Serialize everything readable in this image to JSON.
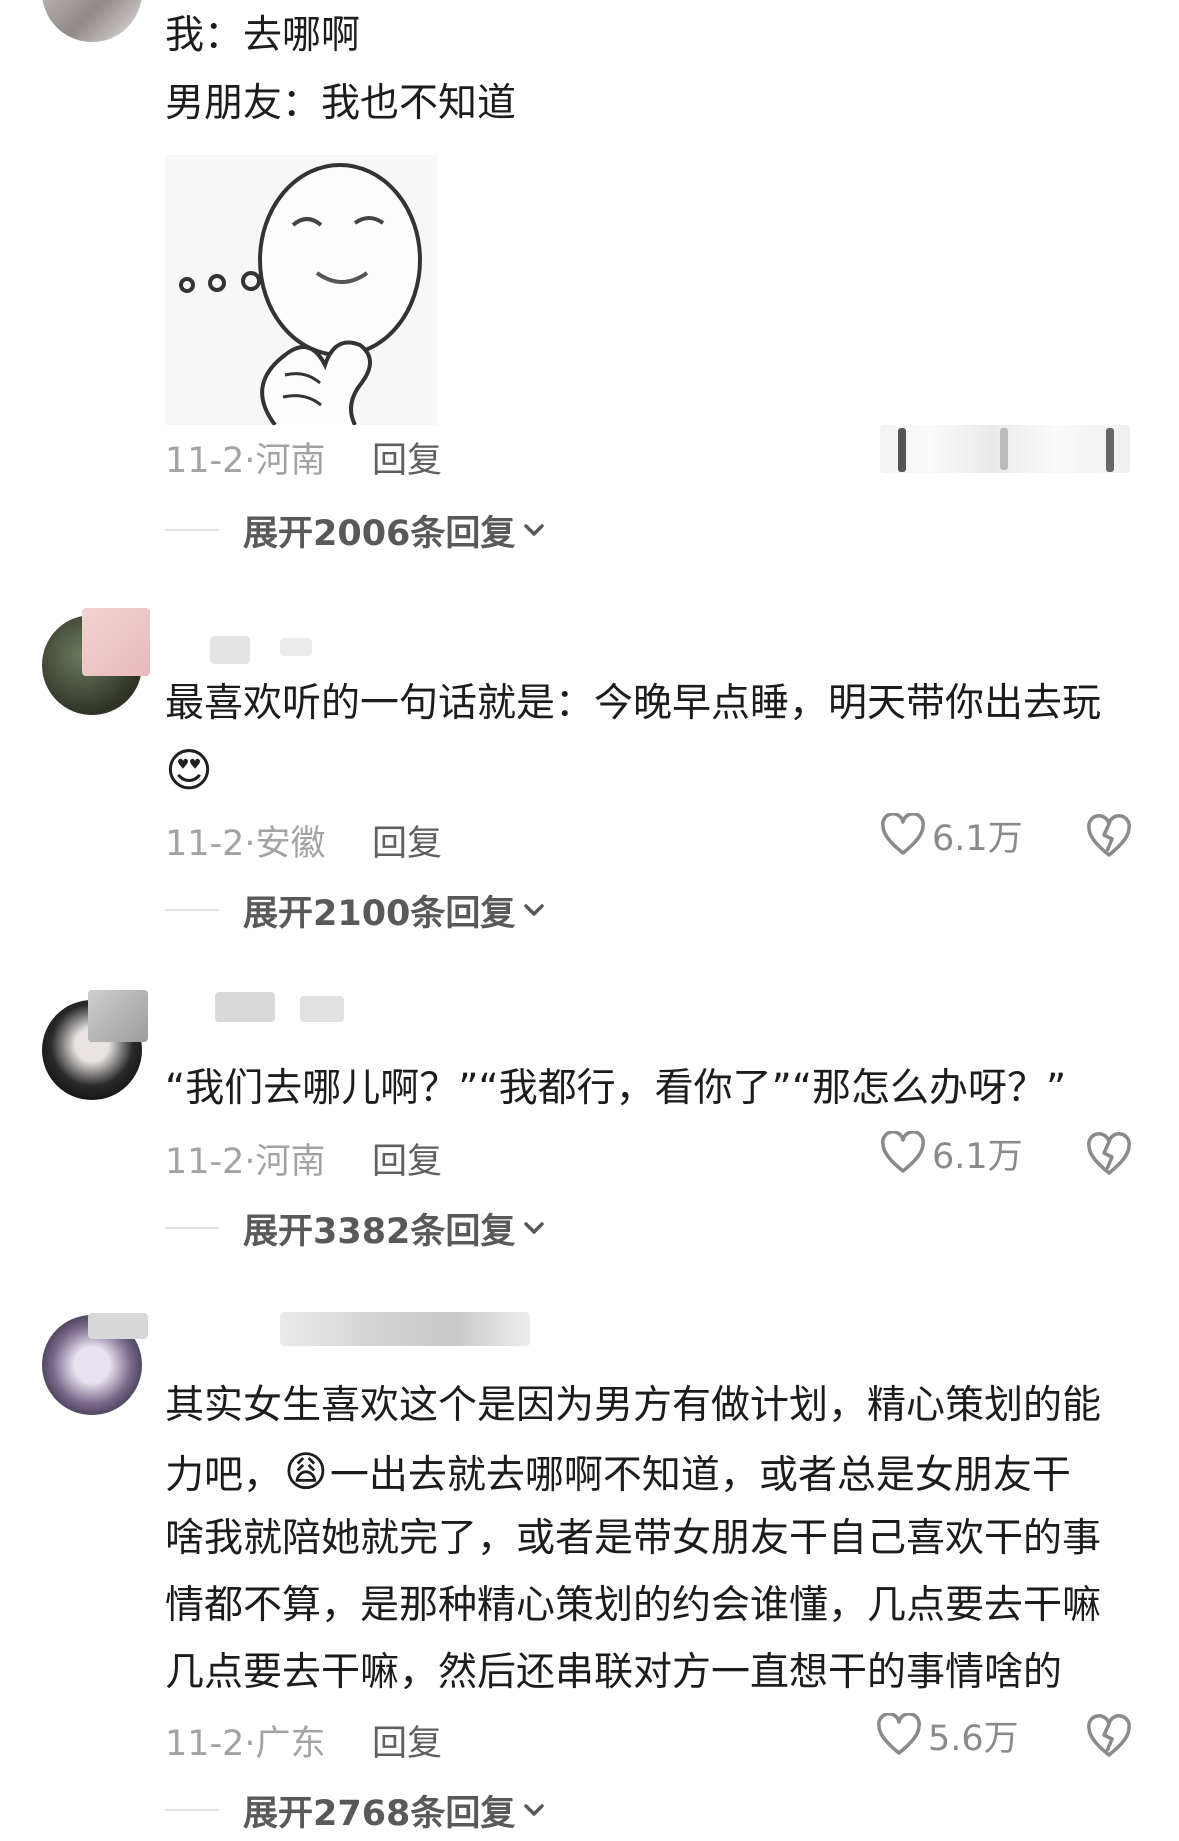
{
  "comments": [
    {
      "lines": [
        "我：去哪啊",
        "男朋友：我也不知道"
      ],
      "date_location": "11-2·河南",
      "reply_label": "回复",
      "expand_label": "展开2006条回复"
    },
    {
      "lines": [
        "最喜欢听的一句话就是：今晚早点睡，明天带你出去玩"
      ],
      "emoji": "😍",
      "date_location": "11-2·安徽",
      "reply_label": "回复",
      "likes": "6.1万",
      "expand_label": "展开2100条回复"
    },
    {
      "lines": [
        "“我们去哪儿啊？”“我都行，看你了”“那怎么办呀？”"
      ],
      "date_location": "11-2·河南",
      "reply_label": "回复",
      "likes": "6.1万",
      "expand_label": "展开3382条回复"
    },
    {
      "lines": [
        "其实女生喜欢这个是因为男方有做计划，精心策划的能",
        "一出去就去哪啊不知道，或者总是女朋友干",
        "啥我就陪她就完了，或者是带女朋友干自己喜欢干的事",
        "情都不算，是那种精心策划的约会谁懂，几点要去干嘛",
        "几点要去干嘛，然后还串联对方一直想干的事情啥的"
      ],
      "line2_prefix": "力吧，",
      "emoji": "😩",
      "date_location": "11-2·广东",
      "reply_label": "回复",
      "likes": "5.6万",
      "expand_label": "展开2768条回复"
    }
  ],
  "colors": {
    "meta": "#a3a3a3",
    "text": "#1c1c1c",
    "expand": "#595959"
  },
  "icons": [
    "heart-outline-icon",
    "broken-heart-icon",
    "chevron-down-icon",
    "thinking-meme-sticker"
  ]
}
